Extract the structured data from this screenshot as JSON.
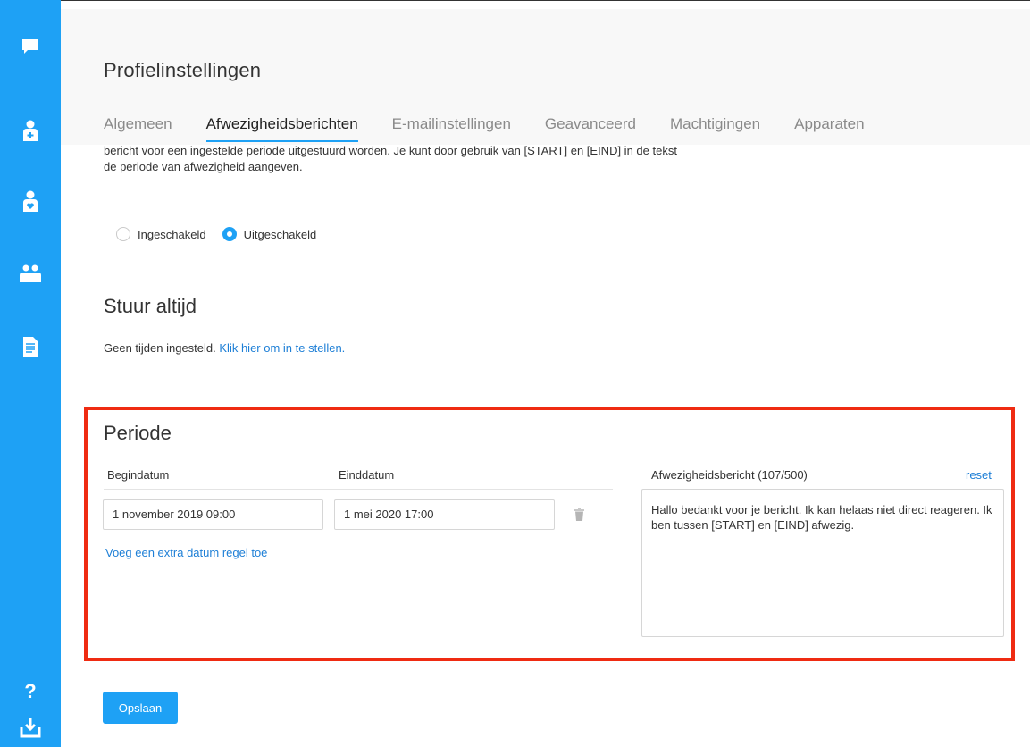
{
  "header": {
    "title": "Profielinstellingen",
    "tabs": [
      {
        "label": "Algemeen"
      },
      {
        "label": "Afwezigheidsberichten"
      },
      {
        "label": "E-mailinstellingen"
      },
      {
        "label": "Geavanceerd"
      },
      {
        "label": "Machtigingen"
      },
      {
        "label": "Apparaten"
      }
    ],
    "active_tab": "Afwezigheidsberichten"
  },
  "intro": {
    "line1": "bericht voor een ingestelde periode uitgestuurd worden. Je kunt door gebruik van [START] en [EIND] in de tekst",
    "line2": "de periode van afwezigheid aangeven."
  },
  "status": {
    "options": [
      {
        "label": "Ingeschakeld",
        "selected": false
      },
      {
        "label": "Uitgeschakeld",
        "selected": true
      }
    ]
  },
  "always": {
    "title": "Stuur altijd",
    "text": "Geen tijden ingesteld.",
    "link": "Klik hier om in te stellen."
  },
  "periode": {
    "title": "Periode",
    "start_label": "Begindatum",
    "end_label": "Einddatum",
    "start_value": "1 november 2019 09:00",
    "end_value": "1 mei 2020 17:00",
    "add_row_link": "Voeg een extra datum regel toe",
    "message_label": "Afwezigheidsbericht (107/500)",
    "reset_link": "reset",
    "message": "Hallo bedankt voor je bericht. Ik kan helaas niet direct reageren. Ik ben tussen [START] en [EIND] afwezig."
  },
  "save_label": "Opslaan",
  "sidebar": {
    "icons": [
      "chat-icon",
      "user-add-icon",
      "user-heart-icon",
      "users-icon",
      "document-icon",
      "help-icon",
      "download-icon"
    ],
    "help_glyph": "?"
  },
  "colors": {
    "accent": "#1ea1f5",
    "highlight_border": "#ef2b12",
    "link": "#1e7fd6"
  }
}
